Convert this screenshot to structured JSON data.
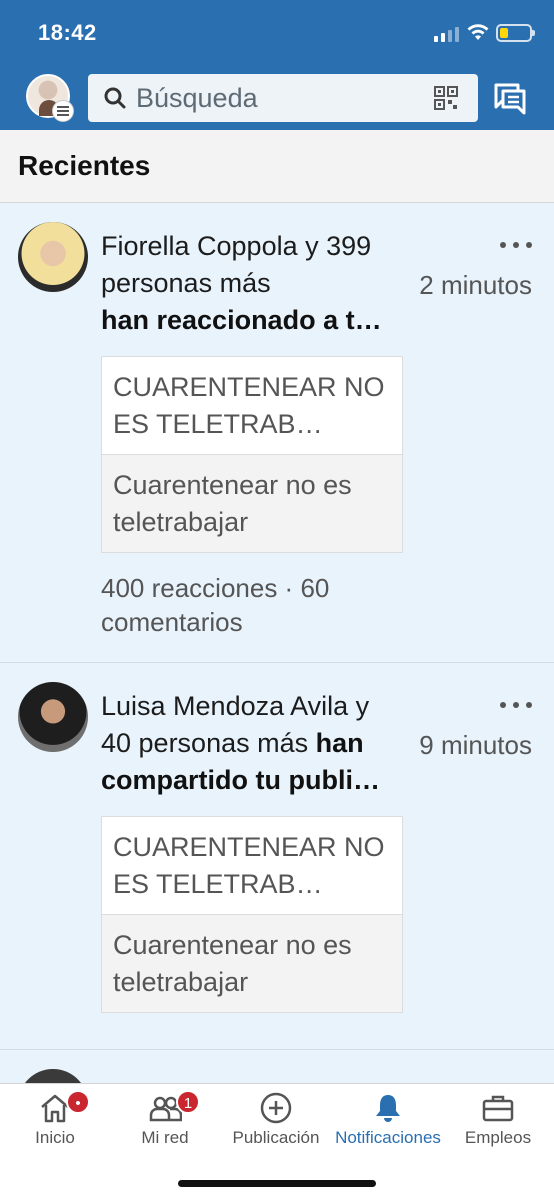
{
  "status_bar": {
    "time": "18:42"
  },
  "header": {
    "search_placeholder": "Búsqueda",
    "icons": {
      "search": "search-icon",
      "qr": "qr-code-icon",
      "messages": "messaging-icon",
      "menu": "menu-icon"
    },
    "brand_color": "#2a6fb0"
  },
  "section": {
    "title": "Recientes"
  },
  "notifications": [
    {
      "text_plain": "Fiorella Coppola y 399 personas más",
      "text_bold": "han reaccionado a t…",
      "time": "2 minutos",
      "card_title": "CUARENTENEAR NO ES TELETRAB…",
      "card_description": "Cuarentenear no es teletrabajar",
      "stats": "400 reacciones · 60 comentarios"
    },
    {
      "text_plain": "Luisa Mendoza Avila y 40 personas más",
      "text_bold": "han compartido tu publi…",
      "time": "9 minutos",
      "card_title": "CUARENTENEAR NO ES TELETRAB…",
      "card_description": "Cuarentenear no es teletrabajar"
    }
  ],
  "tabbar": {
    "tabs": [
      {
        "label": "Inicio",
        "icon": "home-icon",
        "badge": "•"
      },
      {
        "label": "Mi red",
        "icon": "network-icon",
        "badge": "1"
      },
      {
        "label": "Publicación",
        "icon": "add-post-icon"
      },
      {
        "label": "Notificaciones",
        "icon": "bell-icon",
        "active": true
      },
      {
        "label": "Empleos",
        "icon": "briefcase-icon"
      }
    ],
    "active_color": "#2a6fb0",
    "badge_color": "#c9262f"
  }
}
